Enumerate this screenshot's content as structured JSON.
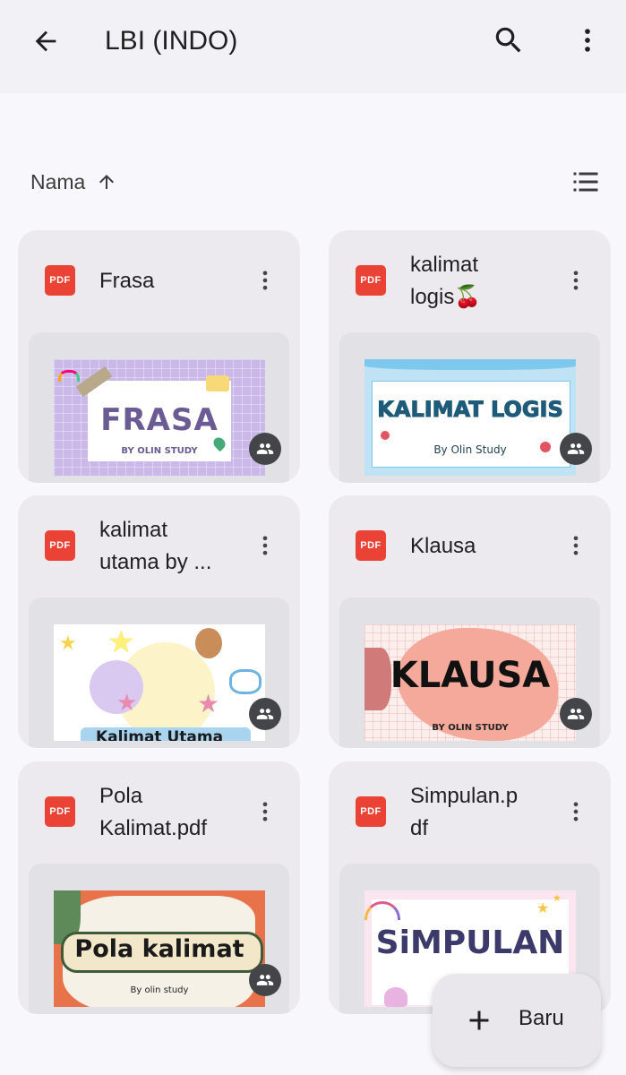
{
  "header": {
    "title": "LBI (INDO)",
    "back_icon": "arrow-back-icon",
    "search_icon": "search-icon",
    "more_icon": "more-vert-icon",
    "background": "#f2f1f5"
  },
  "sort": {
    "label": "Nama",
    "direction_icon": "arrow-up-icon",
    "view_toggle_icon": "list-view-icon"
  },
  "files": [
    {
      "name": "Frasa",
      "type_badge": "PDF",
      "thumb_title": "FRASA",
      "thumb_sub": "BY OLIN STUDY",
      "shared": true
    },
    {
      "name": "kalimat\nlogis🍒",
      "type_badge": "PDF",
      "thumb_title": "KALIMAT LOGIS",
      "thumb_sub": "By Olin Study",
      "shared": true
    },
    {
      "name": "kalimat\nutama by ...",
      "type_badge": "PDF",
      "thumb_title": "Kalimat Utama",
      "thumb_sub": "",
      "shared": true
    },
    {
      "name": "Klausa",
      "type_badge": "PDF",
      "thumb_title": "KLAUSA",
      "thumb_sub": "BY OLIN STUDY",
      "shared": true
    },
    {
      "name": "Pola\nKalimat.pdf",
      "type_badge": "PDF",
      "thumb_title": "Pola kalimat",
      "thumb_sub": "By olin study",
      "shared": true
    },
    {
      "name": "Simpulan.p\ndf",
      "type_badge": "PDF",
      "thumb_title": "SiMPULAN",
      "thumb_sub": "",
      "shared": true
    }
  ],
  "fab": {
    "label": "Baru",
    "icon": "plus-icon"
  },
  "colors": {
    "pdf_red": "#ea4335",
    "card_bg": "#eceaee",
    "shared_badge": "#444548"
  }
}
